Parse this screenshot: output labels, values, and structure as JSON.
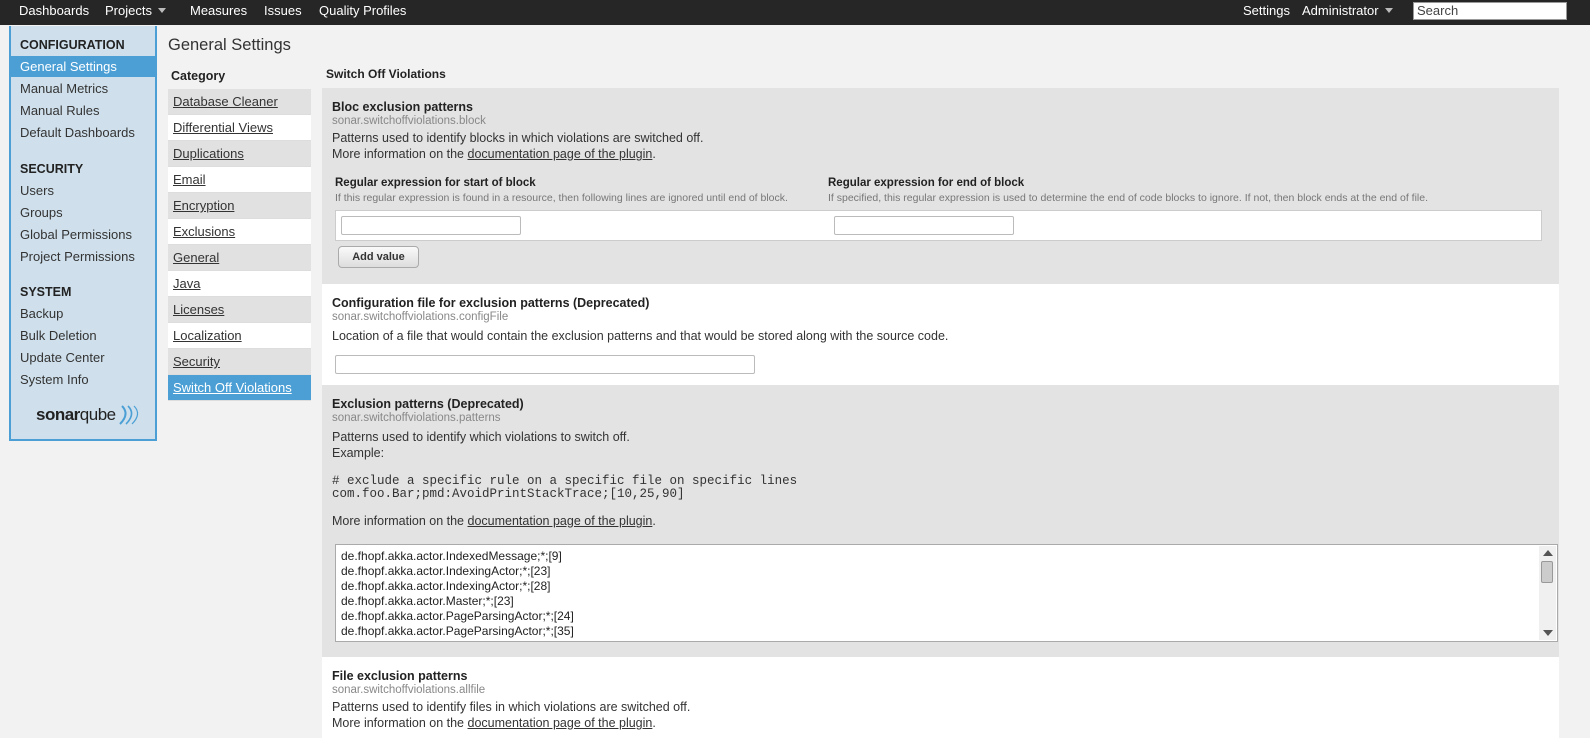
{
  "topbar": {
    "left": [
      "Dashboards",
      "Projects",
      "Measures",
      "Issues",
      "Quality Profiles"
    ],
    "settings": "Settings",
    "user": "Administrator",
    "search_placeholder": "Search"
  },
  "sidebar": {
    "configuration": "CONFIGURATION",
    "config_items": [
      "General Settings",
      "Manual Metrics",
      "Manual Rules",
      "Default Dashboards"
    ],
    "security": "SECURITY",
    "security_items": [
      "Users",
      "Groups",
      "Global Permissions",
      "Project Permissions"
    ],
    "system": "SYSTEM",
    "system_items": [
      "Backup",
      "Bulk Deletion",
      "Update Center",
      "System Info"
    ],
    "logo_bold": "sonar",
    "logo_light": "qube"
  },
  "page_title": "General Settings",
  "category": {
    "header": "Category",
    "items": [
      "Database Cleaner",
      "Differential Views",
      "Duplications",
      "Email",
      "Encryption",
      "Exclusions",
      "General",
      "Java",
      "Licenses",
      "Localization",
      "Security",
      "Switch Off Violations"
    ],
    "selected": "Switch Off Violations"
  },
  "section_title": "Switch Off Violations",
  "bloc": {
    "title": "Bloc exclusion patterns",
    "key": "sonar.switchoffviolations.block",
    "desc": "Patterns used to identify blocks in which violations are switched off.",
    "more_prefix": "More information on the ",
    "more_link": "documentation page of the plugin",
    "more_suffix": ".",
    "start_label": "Regular expression for start of block",
    "start_help": "If this regular expression is found in a resource, then following lines are ignored until end of block.",
    "end_label": "Regular expression for end of block",
    "end_help": "If specified, this regular expression is used to determine the end of code blocks to ignore. If not, then block ends at the end of file.",
    "add_button": "Add value"
  },
  "config_file": {
    "title": "Configuration file for exclusion patterns (Deprecated)",
    "key": "sonar.switchoffviolations.configFile",
    "desc": "Location of a file that would contain the exclusion patterns and that would be stored along with the source code."
  },
  "patterns": {
    "title": "Exclusion patterns (Deprecated)",
    "key": "sonar.switchoffviolations.patterns",
    "desc": "Patterns used to identify which violations to switch off.",
    "example_label": "Example:",
    "code_line1": "# exclude a specific rule on a specific file on specific lines",
    "code_line2": "com.foo.Bar;pmd:AvoidPrintStackTrace;[10,25,90]",
    "more_prefix": "More information on the ",
    "more_link": "documentation page of the plugin",
    "more_suffix": ".",
    "lines": [
      "de.fhopf.akka.actor.IndexedMessage;*;[9]",
      "de.fhopf.akka.actor.IndexingActor;*;[23]",
      "de.fhopf.akka.actor.IndexingActor;*;[28]",
      "de.fhopf.akka.actor.Master;*;[23]",
      "de.fhopf.akka.actor.PageParsingActor;*;[24]",
      "de.fhopf.akka.actor.PageParsingActor;*;[35]"
    ]
  },
  "allfile": {
    "title": "File exclusion patterns",
    "key": "sonar.switchoffviolations.allfile",
    "desc": "Patterns used to identify files in which violations are switched off.",
    "more_prefix": "More information on the ",
    "more_link": "documentation page of the plugin",
    "more_suffix": "."
  }
}
